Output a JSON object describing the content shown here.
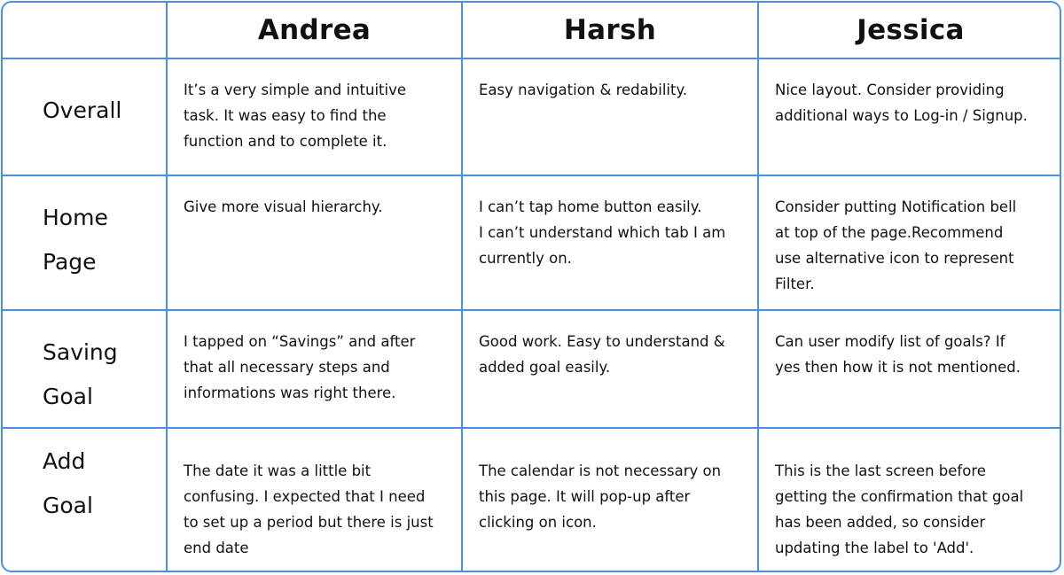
{
  "table": {
    "columns": [
      "Andrea",
      "Harsh",
      "Jessica"
    ],
    "rows": [
      {
        "label": "Overall",
        "cells": [
          "It’s a very simple and intuitive\ntask. It was easy to find the\nfunction and to complete it.",
          "Easy navigation & redability.",
          "Nice layout. Consider providing\nadditional ways to Log-in / Signup."
        ]
      },
      {
        "label": "Home\nPage",
        "cells": [
          "Give more visual hierarchy.",
          "I can’t tap home button easily.\nI can’t understand which tab I am\ncurrently on.",
          "Consider putting Notification bell\nat top of the page.Recommend\nuse alternative icon to represent\nFilter."
        ]
      },
      {
        "label": "Saving\nGoal",
        "cells": [
          "I tapped on “Savings” and after\nthat all necessary steps and\ninformations was right there.",
          "Good work. Easy to understand &\nadded goal easily.",
          "Can user modify list of goals? If\nyes then how it is not mentioned."
        ]
      },
      {
        "label": "Add\nGoal",
        "cells": [
          "The date it was a little bit\nconfusing. I expected that I need\nto set up a period but there is just\nend date",
          "The calendar is not necessary on\nthis page. It will pop-up after\nclicking on icon.",
          "This is the last screen before\ngetting the confirmation that goal\nhas been added, so consider\nupdating the label to 'Add'."
        ]
      }
    ]
  },
  "colors": {
    "border": "#4a90e2",
    "text": "#111111",
    "background": "#ffffff"
  }
}
